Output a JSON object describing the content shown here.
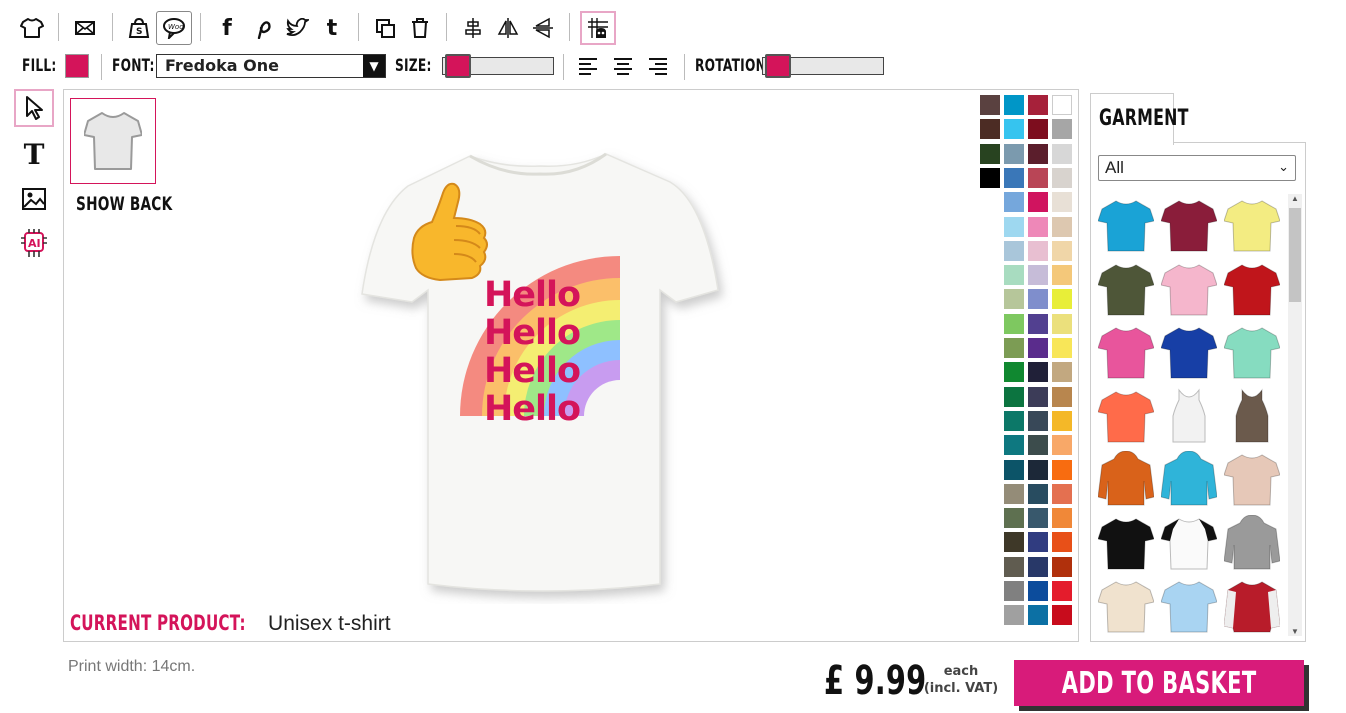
{
  "toolbar": {
    "icons": [
      "tshirt-icon",
      "envelope-icon",
      "bag-icon",
      "chat-icon",
      "facebook-icon",
      "pinterest-icon",
      "twitter-icon",
      "tumblr-icon",
      "duplicate-icon",
      "trash-icon",
      "align-center-icon",
      "flip-horizontal-icon",
      "flip-vertical-icon",
      "grid-icon"
    ]
  },
  "props": {
    "fill_label": "FILL:",
    "font_label": "FONT:",
    "font_value": "Fredoka One",
    "size_label": "SIZE:",
    "rotation_label": "ROTATION:"
  },
  "canvas": {
    "show_back": "SHOW BACK",
    "current_product_label": "CURRENT PRODUCT:",
    "current_product_value": "Unisex t-shirt",
    "hello_lines": [
      "Hello",
      "Hello",
      "Hello",
      "Hello"
    ]
  },
  "palette": [
    [
      "#5a4140",
      "#0096c7",
      "#a6213a",
      "#ffffff"
    ],
    [
      "#4c2c24",
      "#36c4ef",
      "#7d0d1e",
      "#a6a6a6"
    ],
    [
      "#284320",
      "#7b9aae",
      "#5b1e2c",
      "#d7d7d7"
    ],
    [
      "#000000",
      "#3a77b8",
      "#b94556",
      "#d8d3ce"
    ],
    [
      null,
      "#75a7dc",
      "#d0145f",
      "#e8e0d6"
    ],
    [
      null,
      "#9ed8f0",
      "#ee88b8",
      "#ddc8b0"
    ],
    [
      null,
      "#a9c6da",
      "#e8bfd1",
      "#f0d6a8"
    ],
    [
      null,
      "#a8dcc0",
      "#c6bcd8",
      "#f4c87a"
    ],
    [
      null,
      "#b6c69a",
      "#7f8ecc",
      "#e8ee38"
    ],
    [
      null,
      "#7ec860",
      "#524090",
      "#ebe07c"
    ],
    [
      null,
      "#7c9c54",
      "#5a2c8c",
      "#f8e658"
    ],
    [
      null,
      "#108830",
      "#202038",
      "#c2a880"
    ],
    [
      null,
      "#0c7440",
      "#3c3c58",
      "#b8864e"
    ],
    [
      null,
      "#0c7868",
      "#384858",
      "#f4b828"
    ],
    [
      null,
      "#0e7880",
      "#3c4c4c",
      "#f8a868"
    ],
    [
      null,
      "#0c5468",
      "#1c2838",
      "#f86c10"
    ],
    [
      null,
      "#948c78",
      "#284c60",
      "#e47050"
    ],
    [
      null,
      "#5e7050",
      "#38586c",
      "#f08838"
    ],
    [
      null,
      "#3e3828",
      "#303c80",
      "#e85018"
    ],
    [
      null,
      "#605c50",
      "#283868",
      "#b0300c"
    ],
    [
      null,
      "#808080",
      "#0c4c9c",
      "#e41c2c"
    ],
    [
      null,
      "#a0a0a0",
      "#0c70a4",
      "#c80c1c"
    ]
  ],
  "garment": {
    "tab": "GARMENT",
    "filter_value": "All",
    "items": [
      {
        "color": "#1aa3d6",
        "kind": "tee"
      },
      {
        "color": "#8a1d3a",
        "kind": "tee"
      },
      {
        "color": "#f3ec82",
        "kind": "tee"
      },
      {
        "color": "#4e5638",
        "kind": "tee"
      },
      {
        "color": "#f5b6cc",
        "kind": "tee"
      },
      {
        "color": "#c0151b",
        "kind": "tee"
      },
      {
        "color": "#e8559c",
        "kind": "tee"
      },
      {
        "color": "#173fa6",
        "kind": "tee"
      },
      {
        "color": "#86dcc0",
        "kind": "tee"
      },
      {
        "color": "#ff6b4a",
        "kind": "tee"
      },
      {
        "color": "#f2f2f2",
        "kind": "tank"
      },
      {
        "color": "#6b5a4c",
        "kind": "tank"
      },
      {
        "color": "#d9621a",
        "kind": "hoodie"
      },
      {
        "color": "#2fb4d9",
        "kind": "hoodie"
      },
      {
        "color": "#e6c8b8",
        "kind": "tee"
      },
      {
        "color": "#111111",
        "kind": "tee"
      },
      {
        "color": "#fafafa",
        "kind": "raglan"
      },
      {
        "color": "#9a9a9a",
        "kind": "hoodie"
      },
      {
        "color": "#f0e2ce",
        "kind": "tee"
      },
      {
        "color": "#a9d4f2",
        "kind": "tee"
      },
      {
        "color": "#b81c2a",
        "kind": "jacket"
      }
    ]
  },
  "footer": {
    "print_width": "Print width: 14cm.",
    "price": "£ 9.99",
    "each": "each",
    "vat": "(incl. VAT)",
    "basket": "ADD TO BASKET"
  },
  "colors": {
    "accent": "#d4145a",
    "basket": "#d81b7a"
  }
}
